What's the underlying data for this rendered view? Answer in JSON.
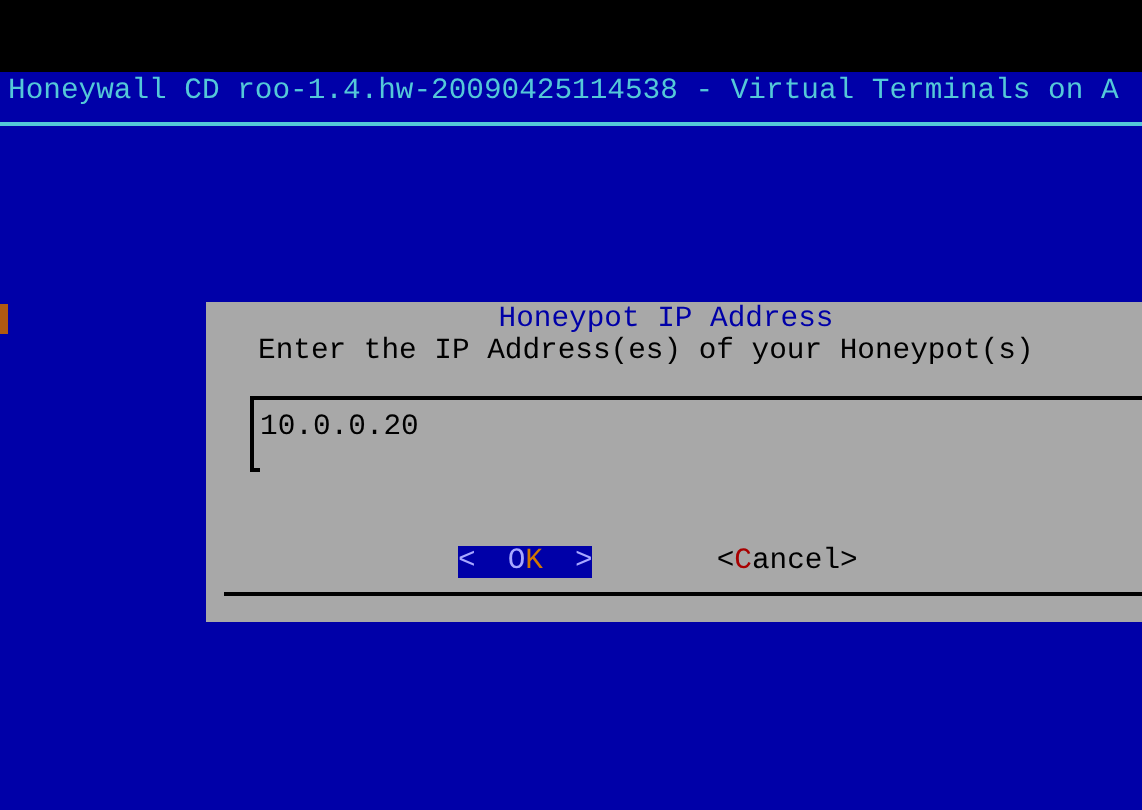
{
  "header": {
    "title": "Honeywall CD roo-1.4.hw-20090425114538 - Virtual Terminals on A"
  },
  "dialog": {
    "title": "Honeypot IP Address",
    "prompt": "Enter the IP Address(es) of your Honeypot(s)",
    "input": {
      "value": "10.0.0.20"
    },
    "buttons": [
      {
        "open": "<",
        "pre": "O",
        "hotkey": "K",
        "close": ">",
        "selected": true
      },
      {
        "open": "<",
        "hotkey": "C",
        "post": "ancel",
        "close": ">",
        "selected": false
      }
    ]
  }
}
